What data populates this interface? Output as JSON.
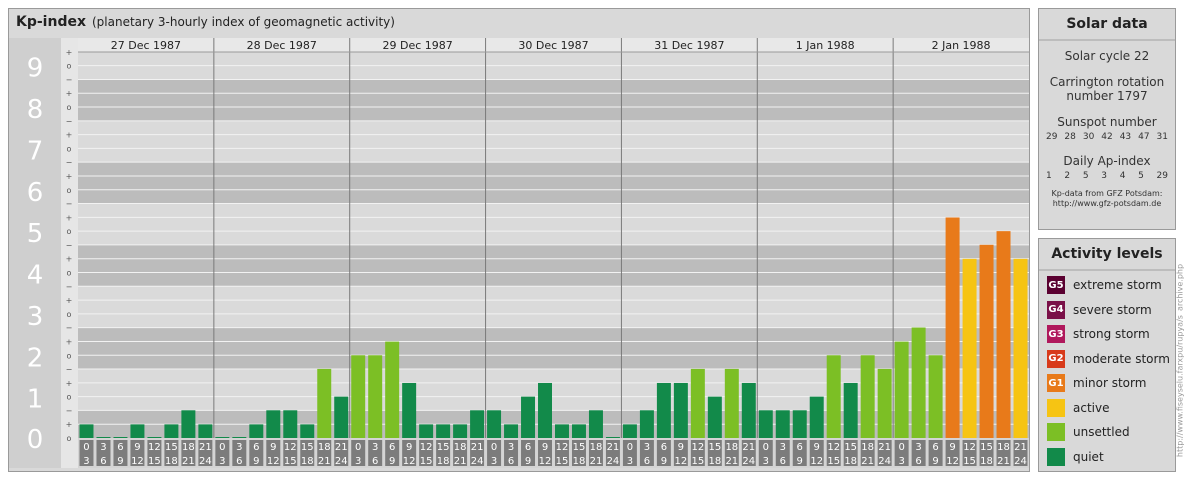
{
  "header": {
    "title": "Kp-index",
    "subtitle": "(planetary 3-hourly index of geomagnetic activity)"
  },
  "chart_data": {
    "type": "bar",
    "title": "Kp-index",
    "subtitle": "(planetary 3-hourly index of geomagnetic activity)",
    "y_major_ticks": [
      "0",
      "1",
      "2",
      "3",
      "4",
      "5",
      "6",
      "7",
      "8",
      "9"
    ],
    "y_minor_labels": [
      "−",
      "o",
      "+"
    ],
    "ylim": [
      0,
      9.33
    ],
    "days": [
      {
        "label": "27 Dec 1987",
        "values": [
          0.33,
          0,
          0,
          0.33,
          0,
          0.33,
          0.67,
          0.33
        ]
      },
      {
        "label": "28 Dec 1987",
        "values": [
          0,
          0,
          0.33,
          0.67,
          0.67,
          0.33,
          1.67,
          1
        ]
      },
      {
        "label": "29 Dec 1987",
        "values": [
          2,
          2,
          2.33,
          1.33,
          0.33,
          0.33,
          0.33,
          0.67
        ]
      },
      {
        "label": "30 Dec 1987",
        "values": [
          0.67,
          0.33,
          1,
          1.33,
          0.33,
          0.33,
          0.67,
          0
        ]
      },
      {
        "label": "31 Dec 1987",
        "values": [
          0.33,
          0.67,
          1.33,
          1.33,
          1.67,
          1,
          1.67,
          1.33
        ]
      },
      {
        "label": "1 Jan 1988",
        "values": [
          0.67,
          0.67,
          0.67,
          1,
          2,
          1.33,
          2,
          1.67
        ]
      },
      {
        "label": "2 Jan 1988",
        "values": [
          2.33,
          2.67,
          2,
          5.33,
          4.33,
          4.67,
          5,
          4.33
        ]
      }
    ],
    "interval_start": [
      "0",
      "3",
      "6",
      "9",
      "12",
      "15",
      "18",
      "21"
    ],
    "interval_end": [
      "3",
      "6",
      "9",
      "12",
      "15",
      "18",
      "21",
      "24"
    ],
    "grid": true
  },
  "solar": {
    "heading": "Solar data",
    "cycle": "Solar cycle 22",
    "carrington_1": "Carrington rotation",
    "carrington_2": "number 1797",
    "sunspot_heading": "Sunspot number",
    "sunspot_values": [
      "29",
      "28",
      "30",
      "42",
      "43",
      "47",
      "31"
    ],
    "ap_heading": "Daily Ap-index",
    "ap_values": [
      "1",
      "2",
      "5",
      "3",
      "4",
      "5",
      "29"
    ],
    "credit_1": "Kp-data from GFZ Potsdam:",
    "credit_2": "http://www.gfz-potsdam.de"
  },
  "activity": {
    "heading": "Activity levels",
    "levels": [
      {
        "badge": "G5",
        "label": "extreme storm",
        "color": "#5a0030"
      },
      {
        "badge": "G4",
        "label": "severe storm",
        "color": "#7a1048"
      },
      {
        "badge": "G3",
        "label": "strong storm",
        "color": "#b0185c"
      },
      {
        "badge": "G2",
        "label": "moderate storm",
        "color": "#d83a1a"
      },
      {
        "badge": "G1",
        "label": "minor storm",
        "color": "#e87a1a"
      },
      {
        "badge": "",
        "label": "active",
        "color": "#f6c413"
      },
      {
        "badge": "",
        "label": "unsettled",
        "color": "#7cbf25"
      },
      {
        "badge": "",
        "label": "quiet",
        "color": "#128a4a"
      }
    ]
  },
  "colors": {
    "quiet": "#128a4a",
    "unsettled": "#7cbf25",
    "active": "#f6c413",
    "minor_storm": "#e87a1a"
  },
  "watermark": "http://www.fiseyselu.farxpu/rupya/s_archive.php"
}
